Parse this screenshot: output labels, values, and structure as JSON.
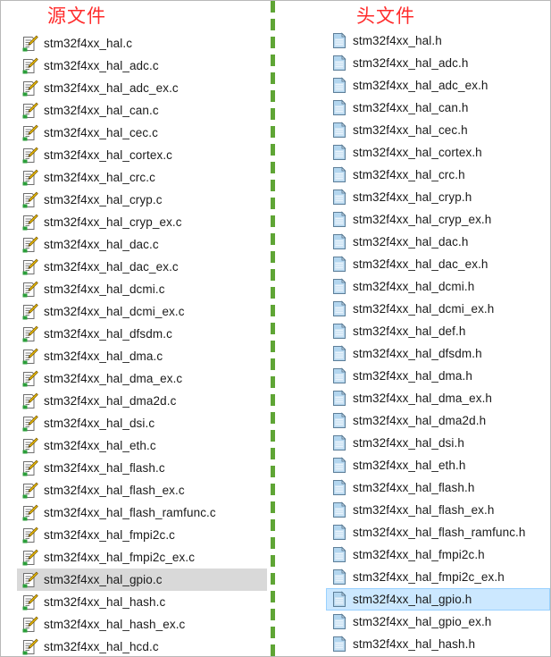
{
  "titles": {
    "left": "源文件",
    "right": "头文件"
  },
  "icons": {
    "source": "c-source-file-icon",
    "header": "header-file-icon"
  },
  "colors": {
    "title": "#ff2b2b",
    "divider": "#5fa535",
    "selected_left": "#d9d9d9",
    "selected_right": "#cce8ff"
  },
  "source_files": [
    "stm32f4xx_hal.c",
    "stm32f4xx_hal_adc.c",
    "stm32f4xx_hal_adc_ex.c",
    "stm32f4xx_hal_can.c",
    "stm32f4xx_hal_cec.c",
    "stm32f4xx_hal_cortex.c",
    "stm32f4xx_hal_crc.c",
    "stm32f4xx_hal_cryp.c",
    "stm32f4xx_hal_cryp_ex.c",
    "stm32f4xx_hal_dac.c",
    "stm32f4xx_hal_dac_ex.c",
    "stm32f4xx_hal_dcmi.c",
    "stm32f4xx_hal_dcmi_ex.c",
    "stm32f4xx_hal_dfsdm.c",
    "stm32f4xx_hal_dma.c",
    "stm32f4xx_hal_dma_ex.c",
    "stm32f4xx_hal_dma2d.c",
    "stm32f4xx_hal_dsi.c",
    "stm32f4xx_hal_eth.c",
    "stm32f4xx_hal_flash.c",
    "stm32f4xx_hal_flash_ex.c",
    "stm32f4xx_hal_flash_ramfunc.c",
    "stm32f4xx_hal_fmpi2c.c",
    "stm32f4xx_hal_fmpi2c_ex.c",
    "stm32f4xx_hal_gpio.c",
    "stm32f4xx_hal_hash.c",
    "stm32f4xx_hal_hash_ex.c",
    "stm32f4xx_hal_hcd.c"
  ],
  "header_files": [
    "stm32f4xx_hal.h",
    "stm32f4xx_hal_adc.h",
    "stm32f4xx_hal_adc_ex.h",
    "stm32f4xx_hal_can.h",
    "stm32f4xx_hal_cec.h",
    "stm32f4xx_hal_cortex.h",
    "stm32f4xx_hal_crc.h",
    "stm32f4xx_hal_cryp.h",
    "stm32f4xx_hal_cryp_ex.h",
    "stm32f4xx_hal_dac.h",
    "stm32f4xx_hal_dac_ex.h",
    "stm32f4xx_hal_dcmi.h",
    "stm32f4xx_hal_dcmi_ex.h",
    "stm32f4xx_hal_def.h",
    "stm32f4xx_hal_dfsdm.h",
    "stm32f4xx_hal_dma.h",
    "stm32f4xx_hal_dma_ex.h",
    "stm32f4xx_hal_dma2d.h",
    "stm32f4xx_hal_dsi.h",
    "stm32f4xx_hal_eth.h",
    "stm32f4xx_hal_flash.h",
    "stm32f4xx_hal_flash_ex.h",
    "stm32f4xx_hal_flash_ramfunc.h",
    "stm32f4xx_hal_fmpi2c.h",
    "stm32f4xx_hal_fmpi2c_ex.h",
    "stm32f4xx_hal_gpio.h",
    "stm32f4xx_hal_gpio_ex.h",
    "stm32f4xx_hal_hash.h"
  ],
  "selected": {
    "source": "stm32f4xx_hal_gpio.c",
    "header": "stm32f4xx_hal_gpio.h"
  }
}
